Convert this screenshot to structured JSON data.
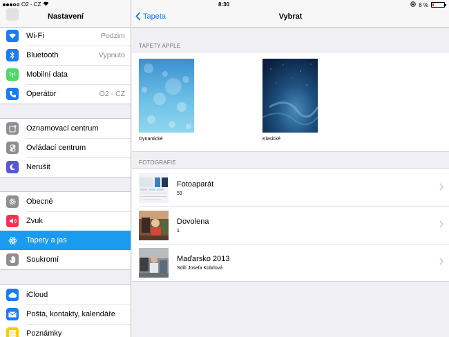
{
  "status_bar": {
    "carrier": "O2 - CZ",
    "time": "8:30",
    "battery": "8 %"
  },
  "left_panel": {
    "title": "Nastavení",
    "groups": [
      {
        "items": [
          {
            "label": "Wi-Fi",
            "value": "Podzim",
            "icon": "wifi-icon",
            "color": "#1a7cf2"
          },
          {
            "label": "Bluetooth",
            "value": "Vypnuto",
            "icon": "bluetooth-icon",
            "color": "#1a7cf2"
          },
          {
            "label": "Mobilní data",
            "value": "",
            "icon": "cellular-icon",
            "color": "#4cd964"
          },
          {
            "label": "Operátor",
            "value": "O2 - CZ",
            "icon": "phone-icon",
            "color": "#1a7cf2"
          }
        ]
      },
      {
        "items": [
          {
            "label": "Oznamovací centrum",
            "icon": "notification-center-icon",
            "color": "#8e8e93"
          },
          {
            "label": "Ovládací centrum",
            "icon": "control-center-icon",
            "color": "#8e8e93"
          },
          {
            "label": "Nerušit",
            "icon": "moon-icon",
            "color": "#5856d6"
          }
        ]
      },
      {
        "items": [
          {
            "label": "Obecné",
            "icon": "gear-icon",
            "color": "#8e8e93"
          },
          {
            "label": "Zvuk",
            "icon": "speaker-icon",
            "color": "#ff2d55"
          },
          {
            "label": "Tapety a jas",
            "icon": "wallpaper-icon",
            "color": "#1a9bf0",
            "selected": true
          },
          {
            "label": "Soukromí",
            "icon": "hand-icon",
            "color": "#8e8e93"
          }
        ]
      },
      {
        "items": [
          {
            "label": "iCloud",
            "icon": "cloud-icon",
            "color": "#1a7cf2"
          },
          {
            "label": "Pošta, kontakty, kalendáře",
            "icon": "mail-icon",
            "color": "#1a7cf2"
          },
          {
            "label": "Poznámky",
            "icon": "notes-icon",
            "color": "#ffcc00"
          }
        ]
      }
    ]
  },
  "right_panel": {
    "back_label": "Tapeta",
    "title": "Vybrat",
    "apple_section_header": "TAPETY APPLE",
    "wallpapers": [
      {
        "caption": "Dynamické"
      },
      {
        "caption": "Klasické"
      }
    ],
    "photos_section_header": "FOTOGRAFIE",
    "albums": [
      {
        "name": "Fotoaparát",
        "count": "59"
      },
      {
        "name": "Dovolena",
        "count": "1"
      },
      {
        "name": "Maďarsko 2013",
        "count": "Sdílí Josefa Kobrlová"
      }
    ]
  },
  "colors": {
    "accent": "#1a7cf2",
    "selection": "#1a9bf0"
  }
}
